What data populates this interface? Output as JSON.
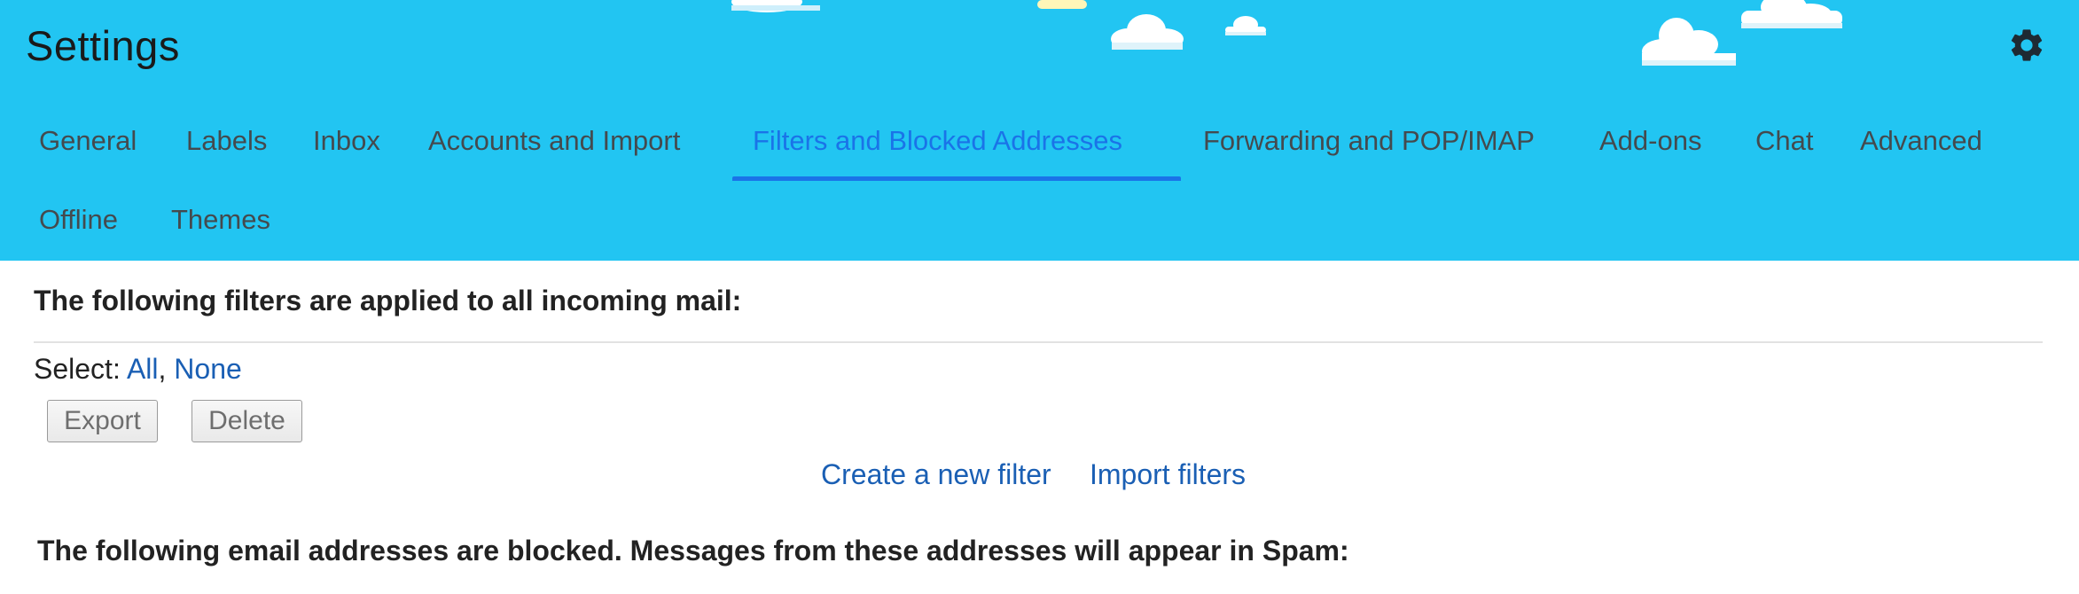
{
  "header": {
    "title": "Settings",
    "settings_icon": "gear-icon",
    "background_color": "#22c5f2"
  },
  "tabs": [
    {
      "label": "General",
      "active": false
    },
    {
      "label": "Labels",
      "active": false
    },
    {
      "label": "Inbox",
      "active": false
    },
    {
      "label": "Accounts and Import",
      "active": false
    },
    {
      "label": "Filters and Blocked Addresses",
      "active": true
    },
    {
      "label": "Forwarding and POP/IMAP",
      "active": false
    },
    {
      "label": "Add-ons",
      "active": false
    },
    {
      "label": "Chat",
      "active": false
    },
    {
      "label": "Advanced",
      "active": false
    },
    {
      "label": "Offline",
      "active": false
    },
    {
      "label": "Themes",
      "active": false
    }
  ],
  "filters": {
    "heading": "The following filters are applied to all incoming mail:",
    "select_label": "Select:",
    "select_all": "All",
    "select_separator": ",",
    "select_none": "None",
    "export_label": "Export",
    "delete_label": "Delete",
    "create_link": "Create a new filter",
    "import_link": "Import filters"
  },
  "blocked": {
    "heading": "The following email addresses are blocked. Messages from these addresses will appear in Spam:"
  },
  "colors": {
    "accent": "#1a73e8",
    "link": "#1a5fb4"
  }
}
